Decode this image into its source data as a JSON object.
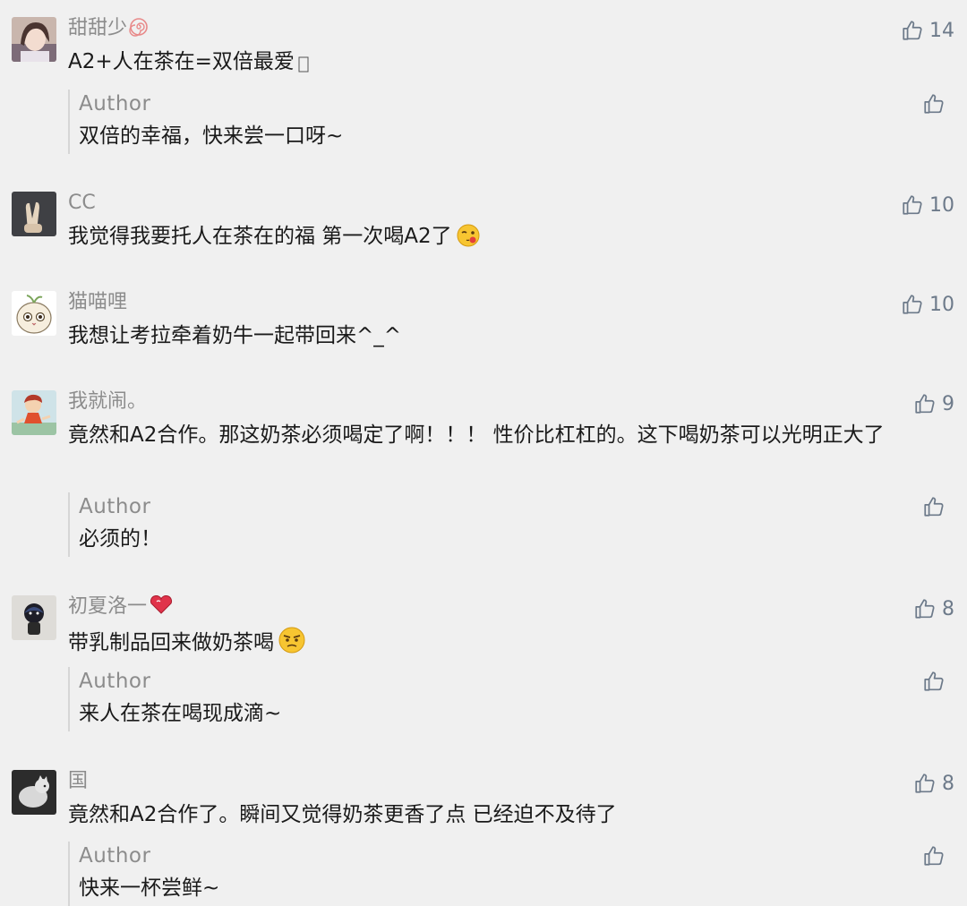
{
  "reply_author_label": "Author",
  "comments": [
    {
      "nickname": "甜甜少",
      "text": "A2+人在茶在=双倍最爱",
      "likes": "14",
      "reply": "双倍的幸福，快来尝一口呀~"
    },
    {
      "nickname": "CC",
      "text": "我觉得我要托人在茶在的福  第一次喝A2了",
      "likes": "10"
    },
    {
      "nickname": "猫喵哩",
      "text": "我想让考拉牵着奶牛一起带回来^_^",
      "likes": "10"
    },
    {
      "nickname": "我就闹。",
      "text": "竟然和A2合作。那这奶茶必须喝定了啊！！！ 性价比杠杠的。这下喝奶茶可以光明正大了",
      "likes": "9",
      "reply": "必须的！"
    },
    {
      "nickname": "初夏洛一",
      "text": "带乳制品回来做奶茶喝",
      "likes": "8",
      "reply": "来人在茶在喝现成滴~"
    },
    {
      "nickname": "国",
      "text": "竟然和A2合作了。瞬间又觉得奶茶更香了点  已经迫不及待了",
      "likes": "8",
      "reply": "快来一杯尝鲜~"
    }
  ],
  "colors": {
    "background": "#f0f0f0",
    "nickname": "#8c8c8c",
    "body_text": "#1a1a1a",
    "like_icon": "#6d7a8a"
  }
}
